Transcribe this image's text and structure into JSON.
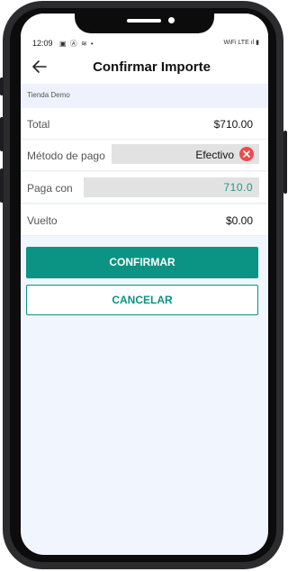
{
  "status_bar": {
    "time": "12:09",
    "left_icons": "▣ Ⓐ ≋ •",
    "right_icons": "WiFi LTE ıl ▮"
  },
  "app_bar": {
    "title": "Confirmar Importe"
  },
  "store": {
    "name": "Tienda Demo"
  },
  "rows": {
    "total": {
      "label": "Total",
      "value": "$710.00"
    },
    "method": {
      "label": "Método de pago",
      "value": "Efectivo"
    },
    "pay_with": {
      "label": "Paga con",
      "value": "710.0"
    },
    "change": {
      "label": "Vuelto",
      "value": "$0.00"
    }
  },
  "buttons": {
    "confirm_label": "CONFIRMAR",
    "cancel_label": "CANCELAR"
  },
  "colors": {
    "accent": "#0b9483",
    "danger": "#ee4b4b",
    "background": "#f1f5fe"
  },
  "icons": {
    "back": "arrow-left-icon",
    "clear": "close-circle-icon"
  }
}
